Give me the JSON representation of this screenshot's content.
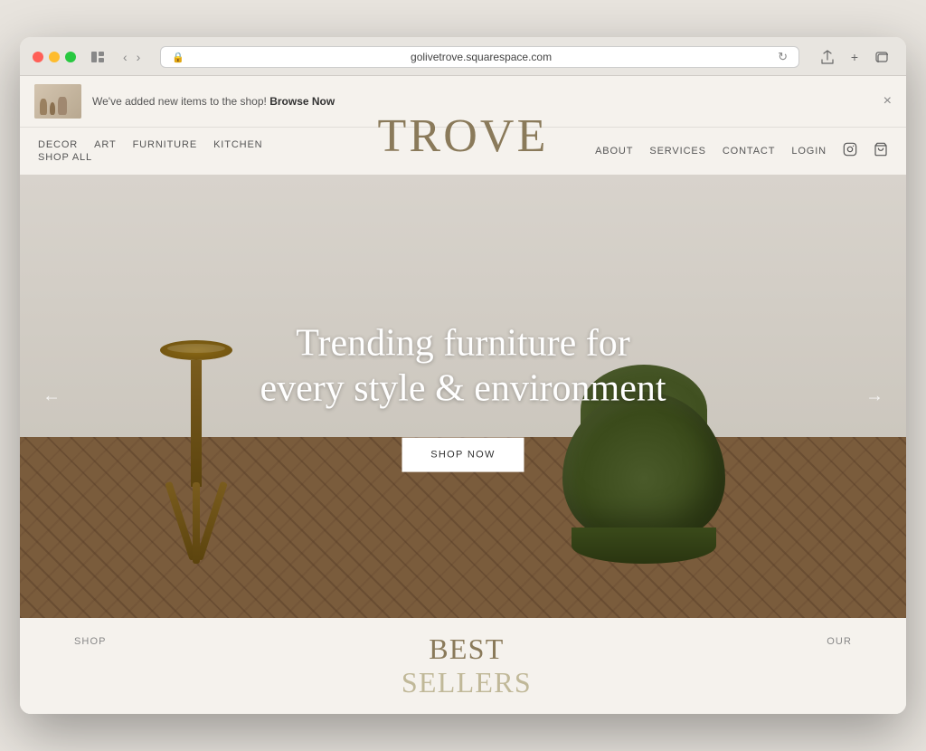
{
  "browser": {
    "url": "golivetrove.squarespace.com",
    "reload_icon": "↻"
  },
  "announcement": {
    "text": "We've added new items to the shop!",
    "cta": "Browse Now",
    "close_label": "×"
  },
  "nav": {
    "left_items": [
      {
        "label": "DECOR",
        "id": "decor"
      },
      {
        "label": "ART",
        "id": "art"
      },
      {
        "label": "FURNITURE",
        "id": "furniture"
      },
      {
        "label": "KITCHEN",
        "id": "kitchen"
      }
    ],
    "left_items_row2": [
      {
        "label": "SHOP ALL",
        "id": "shop-all"
      }
    ],
    "logo": "TROVE",
    "right_items": [
      {
        "label": "ABOUT",
        "id": "about"
      },
      {
        "label": "SERVICES",
        "id": "services"
      },
      {
        "label": "CONTACT",
        "id": "contact"
      },
      {
        "label": "LOGIN",
        "id": "login"
      }
    ]
  },
  "hero": {
    "headline_line1": "Trending furniture for",
    "headline_line2": "every style & environment",
    "cta_label": "SHOP NOW",
    "arrow_left": "←",
    "arrow_right": "→"
  },
  "below_hero": {
    "shop_label": "SHOP",
    "best_sellers_line1": "BEST",
    "best_sellers_line2": "SELLERS",
    "our_label": "OUR"
  }
}
